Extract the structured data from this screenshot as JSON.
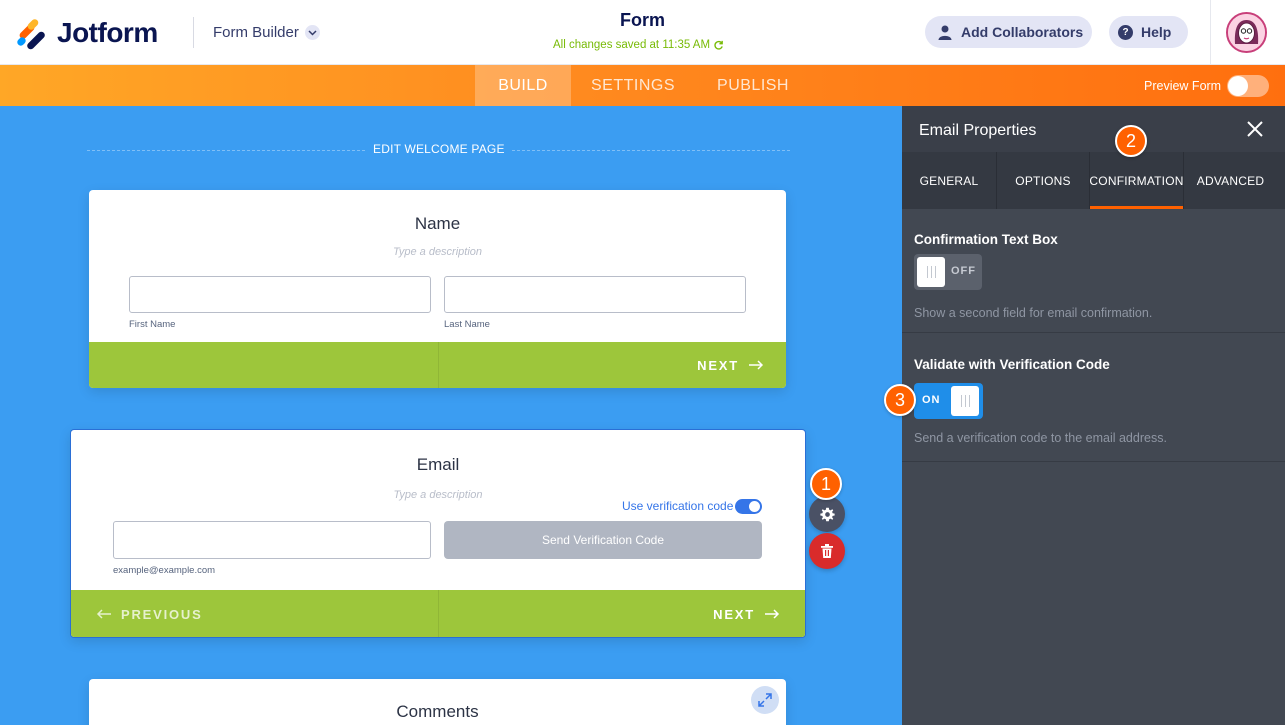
{
  "header": {
    "brand": "Jotform",
    "builder_label": "Form Builder",
    "form_title": "Form",
    "save_status": "All changes saved at 11:35 AM",
    "add_collaborators": "Add Collaborators",
    "help": "Help"
  },
  "tabs": {
    "build": "BUILD",
    "settings": "SETTINGS",
    "publish": "PUBLISH",
    "preview_form": "Preview Form",
    "active": "BUILD"
  },
  "canvas": {
    "welcome": "EDIT WELCOME PAGE",
    "name_card": {
      "title": "Name",
      "description": "Type a description",
      "first_name_label": "First Name",
      "last_name_label": "Last Name",
      "next": "NEXT"
    },
    "email_card": {
      "title": "Email",
      "description": "Type a description",
      "use_verification": "Use verification code",
      "send_button": "Send Verification Code",
      "example": "example@example.com",
      "previous": "PREVIOUS",
      "next": "NEXT"
    },
    "comments_card": {
      "title": "Comments"
    }
  },
  "steps": [
    "1",
    "2",
    "3"
  ],
  "panel": {
    "title": "Email Properties",
    "tabs": [
      "GENERAL",
      "OPTIONS",
      "CONFIRMATION",
      "ADVANCED"
    ],
    "active_tab": "CONFIRMATION",
    "confirmation": {
      "heading": "Confirmation Text Box",
      "state": "OFF",
      "hint": "Show a second field for email confirmation."
    },
    "verification": {
      "heading": "Validate with Verification Code",
      "state": "ON",
      "hint": "Send a verification code to the email address."
    }
  },
  "colors": {
    "canvas": "#3b9df2",
    "accent": "#ff6100",
    "nav_green": "#9dc63b",
    "panel": "#424852",
    "toggle_on": "#1f8ee9"
  }
}
